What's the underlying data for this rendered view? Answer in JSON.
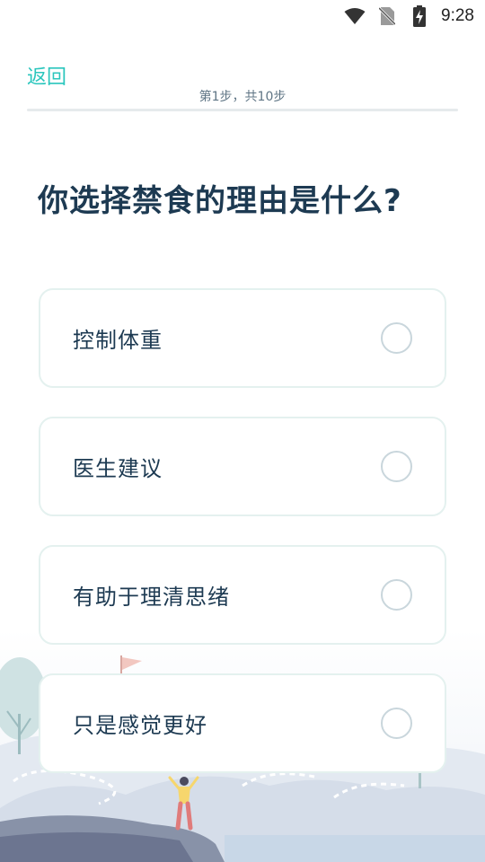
{
  "status_bar": {
    "time": "9:28",
    "icons": [
      "wifi-icon",
      "no-sim-icon",
      "battery-charging-icon"
    ]
  },
  "header": {
    "back_label": "返回",
    "step_text": "第1步，共10步"
  },
  "question": "你选择禁食的理由是什么?",
  "options": [
    {
      "label": "控制体重",
      "selected": false
    },
    {
      "label": "医生建议",
      "selected": false
    },
    {
      "label": "有助于理清思绪",
      "selected": false
    },
    {
      "label": "只是感觉更好",
      "selected": false
    }
  ],
  "colors": {
    "accent": "#2bc6bd",
    "title": "#1d3a52",
    "card_border": "#e4f1ef",
    "radio_border": "#c9d6dc"
  }
}
